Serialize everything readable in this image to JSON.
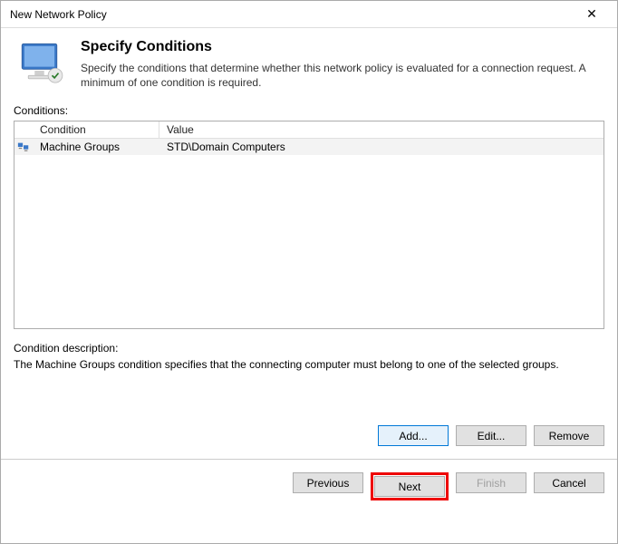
{
  "titlebar": {
    "title": "New Network Policy"
  },
  "header": {
    "heading": "Specify Conditions",
    "subtext": "Specify the conditions that determine whether this network policy is evaluated for a connection request. A minimum of one condition is required."
  },
  "conditions": {
    "label": "Conditions:",
    "columns": {
      "condition": "Condition",
      "value": "Value"
    },
    "rows": [
      {
        "icon": "machine-groups-icon",
        "condition": "Machine Groups",
        "value": "STD\\Domain Computers"
      }
    ]
  },
  "description": {
    "label": "Condition description:",
    "text": "The Machine Groups condition specifies that the connecting computer must belong to one of the selected groups."
  },
  "buttons": {
    "add": "Add...",
    "edit": "Edit...",
    "remove": "Remove",
    "previous": "Previous",
    "next": "Next",
    "finish": "Finish",
    "cancel": "Cancel"
  }
}
